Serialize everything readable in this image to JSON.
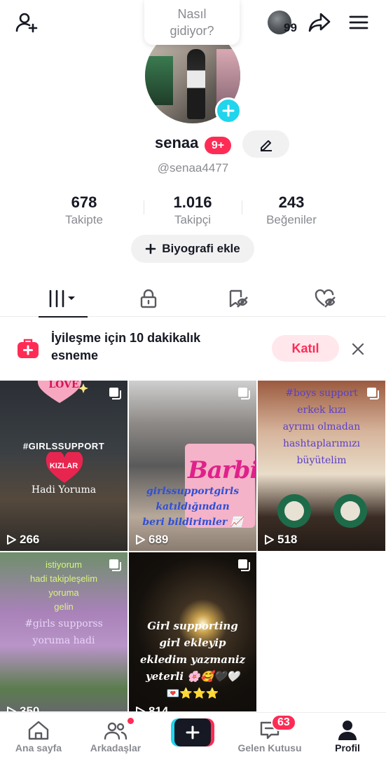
{
  "header": {
    "status_bubble_line1": "Nasıl",
    "status_bubble_line2": "gidiyor?",
    "avatar_notification_count": "99"
  },
  "profile": {
    "username": "senaa",
    "notification_badge": "9+",
    "handle": "@senaa4477"
  },
  "stats": [
    {
      "value": "678",
      "label": "Takipte"
    },
    {
      "value": "1.016",
      "label": "Takipçi"
    },
    {
      "value": "243",
      "label": "Beğeniler"
    }
  ],
  "bio_button": {
    "label": "Biyografi ekle"
  },
  "tabs": [
    {
      "icon": "grid-icon",
      "active": true
    },
    {
      "icon": "lock-icon",
      "active": false
    },
    {
      "icon": "bookmark-eye-icon",
      "active": false
    },
    {
      "icon": "heart-eye-icon",
      "active": false
    }
  ],
  "promo": {
    "text": "İyileşme için 10 dakikalık esneme",
    "join_label": "Katıl"
  },
  "videos": [
    {
      "views": "266",
      "caption_lines": [
        "#GIRLSSUPPORT",
        "KIZLAR",
        "Hadi Yoruma"
      ],
      "sticker": "LOVE"
    },
    {
      "views": "689",
      "caption_lines": [
        "girlssupportgirls",
        "katıldığından",
        "beri bildirimler 📈"
      ],
      "brand": "Barbie"
    },
    {
      "views": "518",
      "caption_lines": [
        "#boys support",
        "erkek kızı",
        "ayrımı olmadan",
        "hashtaplarımızı",
        "büyütelim"
      ]
    },
    {
      "views": "350",
      "caption_lines": [
        "istiyorum",
        "hadi takipleşelim",
        "yoruma",
        "gelin",
        "#girls supporss",
        "yoruma hadi"
      ]
    },
    {
      "views": "814",
      "caption_lines": [
        "Girl supporting",
        "girl ekleyip",
        "ekledim yazmaniz",
        "yeterli 🌸🥰🖤🤍",
        "💌⭐⭐⭐"
      ]
    }
  ],
  "bottom_nav": [
    {
      "label": "Ana sayfa",
      "icon": "home-icon"
    },
    {
      "label": "Arkadaşlar",
      "icon": "friends-icon"
    },
    {
      "label": "",
      "icon": "plus-icon"
    },
    {
      "label": "Gelen Kutusu",
      "icon": "inbox-icon",
      "badge": "63"
    },
    {
      "label": "Profil",
      "icon": "profile-icon"
    }
  ],
  "colors": {
    "accent_red": "#fe2c55",
    "accent_cyan": "#20d5ec",
    "text_primary": "#161823",
    "text_secondary": "#8a8b91"
  }
}
